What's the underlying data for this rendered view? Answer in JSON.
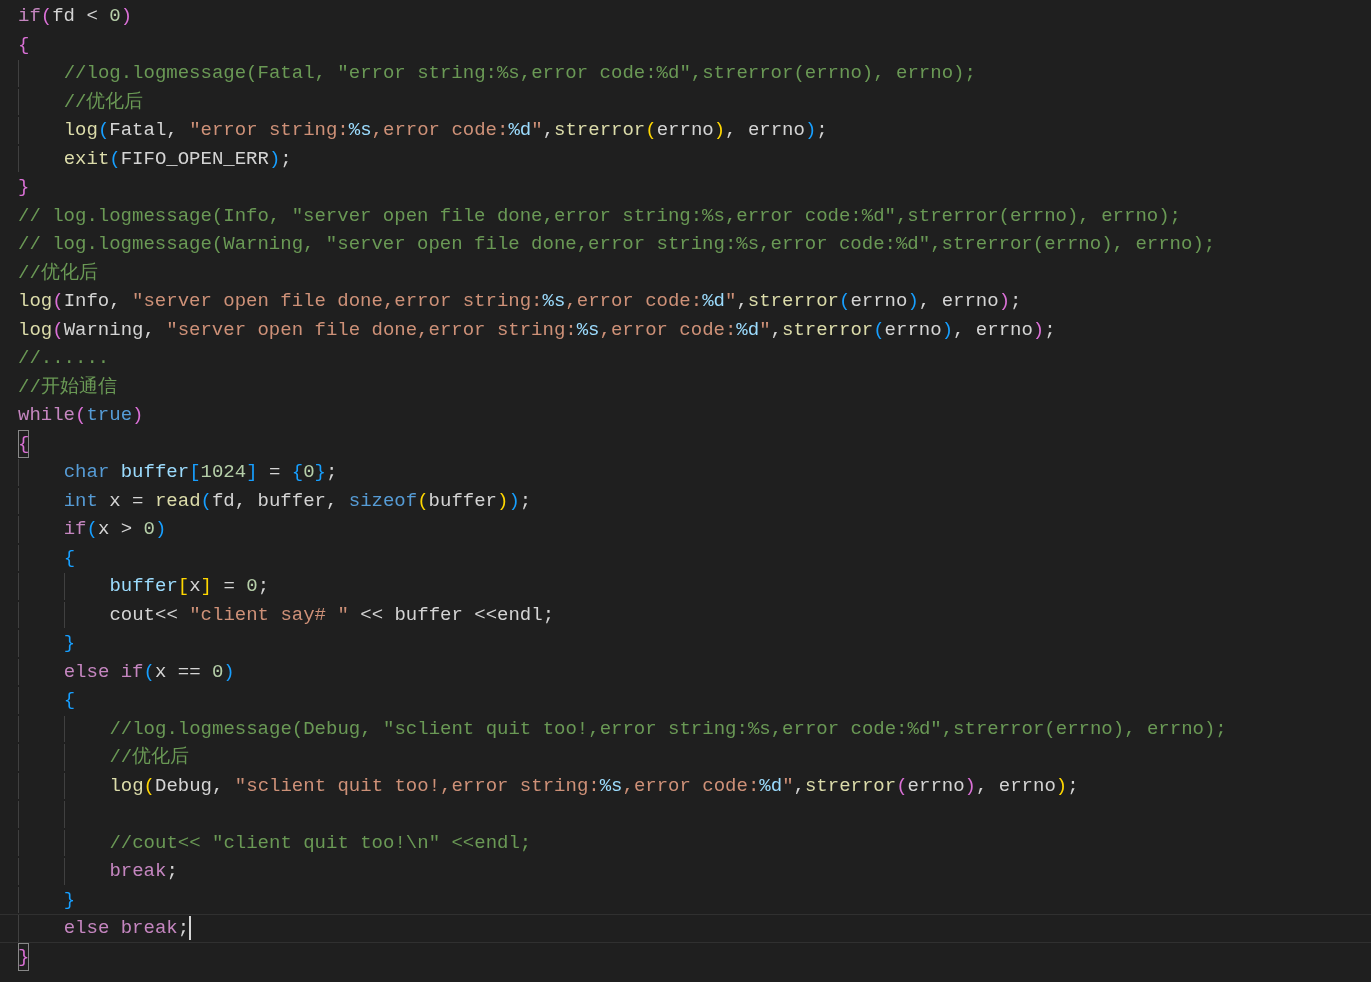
{
  "editor": {
    "lines": [
      {
        "active": false,
        "tokens": [
          {
            "kind": "keyword",
            "text": "if"
          },
          {
            "kind": "bracket1",
            "text": "("
          },
          {
            "kind": "plain",
            "text": "fd < "
          },
          {
            "kind": "number",
            "text": "0"
          },
          {
            "kind": "bracket1",
            "text": ")"
          }
        ]
      },
      {
        "active": false,
        "tokens": [
          {
            "kind": "bracket1",
            "text": "{"
          }
        ]
      },
      {
        "active": false,
        "tokens": [
          {
            "kind": "indent"
          },
          {
            "kind": "comment",
            "text": "//log.logmessage(Fatal, \"error string:%s,error code:%d\",strerror(errno), errno);"
          }
        ]
      },
      {
        "active": false,
        "tokens": [
          {
            "kind": "indent"
          },
          {
            "kind": "comment",
            "text": "//优化后"
          }
        ]
      },
      {
        "active": false,
        "tokens": [
          {
            "kind": "indent"
          },
          {
            "kind": "function",
            "text": "log"
          },
          {
            "kind": "bracket2",
            "text": "("
          },
          {
            "kind": "plain",
            "text": "Fatal, "
          },
          {
            "kind": "string",
            "text": "\"error string:"
          },
          {
            "kind": "format",
            "text": "%s"
          },
          {
            "kind": "string",
            "text": ",error code:"
          },
          {
            "kind": "format",
            "text": "%d"
          },
          {
            "kind": "string",
            "text": "\""
          },
          {
            "kind": "plain",
            "text": ","
          },
          {
            "kind": "function",
            "text": "strerror"
          },
          {
            "kind": "bracket3",
            "text": "("
          },
          {
            "kind": "plain",
            "text": "errno"
          },
          {
            "kind": "bracket3",
            "text": ")"
          },
          {
            "kind": "plain",
            "text": ", errno"
          },
          {
            "kind": "bracket2",
            "text": ")"
          },
          {
            "kind": "plain",
            "text": ";"
          }
        ]
      },
      {
        "active": false,
        "tokens": [
          {
            "kind": "indent"
          },
          {
            "kind": "function",
            "text": "exit"
          },
          {
            "kind": "bracket2",
            "text": "("
          },
          {
            "kind": "plain",
            "text": "FIFO_OPEN_ERR"
          },
          {
            "kind": "bracket2",
            "text": ")"
          },
          {
            "kind": "plain",
            "text": ";"
          }
        ]
      },
      {
        "active": false,
        "tokens": [
          {
            "kind": "bracket1",
            "text": "}"
          }
        ]
      },
      {
        "active": false,
        "tokens": [
          {
            "kind": "comment",
            "text": "// log.logmessage(Info, \"server open file done,error string:%s,error code:%d\",strerror(errno), errno);"
          }
        ]
      },
      {
        "active": false,
        "tokens": [
          {
            "kind": "comment",
            "text": "// log.logmessage(Warning, \"server open file done,error string:%s,error code:%d\",strerror(errno), errno);"
          }
        ]
      },
      {
        "active": false,
        "tokens": [
          {
            "kind": "comment",
            "text": "//优化后"
          }
        ]
      },
      {
        "active": false,
        "tokens": [
          {
            "kind": "function",
            "text": "log"
          },
          {
            "kind": "bracket1",
            "text": "("
          },
          {
            "kind": "plain",
            "text": "Info, "
          },
          {
            "kind": "string",
            "text": "\"server open file done,error string:"
          },
          {
            "kind": "format",
            "text": "%s"
          },
          {
            "kind": "string",
            "text": ",error code:"
          },
          {
            "kind": "format",
            "text": "%d"
          },
          {
            "kind": "string",
            "text": "\""
          },
          {
            "kind": "plain",
            "text": ","
          },
          {
            "kind": "function",
            "text": "strerror"
          },
          {
            "kind": "bracket2",
            "text": "("
          },
          {
            "kind": "plain",
            "text": "errno"
          },
          {
            "kind": "bracket2",
            "text": ")"
          },
          {
            "kind": "plain",
            "text": ", errno"
          },
          {
            "kind": "bracket1",
            "text": ")"
          },
          {
            "kind": "plain",
            "text": ";"
          }
        ]
      },
      {
        "active": false,
        "tokens": [
          {
            "kind": "function",
            "text": "log"
          },
          {
            "kind": "bracket1",
            "text": "("
          },
          {
            "kind": "plain",
            "text": "Warning, "
          },
          {
            "kind": "string",
            "text": "\"server open file done,error string:"
          },
          {
            "kind": "format",
            "text": "%s"
          },
          {
            "kind": "string",
            "text": ",error code:"
          },
          {
            "kind": "format",
            "text": "%d"
          },
          {
            "kind": "string",
            "text": "\""
          },
          {
            "kind": "plain",
            "text": ","
          },
          {
            "kind": "function",
            "text": "strerror"
          },
          {
            "kind": "bracket2",
            "text": "("
          },
          {
            "kind": "plain",
            "text": "errno"
          },
          {
            "kind": "bracket2",
            "text": ")"
          },
          {
            "kind": "plain",
            "text": ", errno"
          },
          {
            "kind": "bracket1",
            "text": ")"
          },
          {
            "kind": "plain",
            "text": ";"
          }
        ]
      },
      {
        "active": false,
        "tokens": [
          {
            "kind": "comment",
            "text": "//......"
          }
        ]
      },
      {
        "active": false,
        "tokens": [
          {
            "kind": "comment",
            "text": "//开始通信"
          }
        ]
      },
      {
        "active": false,
        "tokens": [
          {
            "kind": "keyword",
            "text": "while"
          },
          {
            "kind": "bracket1",
            "text": "("
          },
          {
            "kind": "type",
            "text": "true"
          },
          {
            "kind": "bracket1",
            "text": ")"
          }
        ]
      },
      {
        "active": false,
        "tokens": [
          {
            "kind": "matched",
            "text": "{"
          }
        ]
      },
      {
        "active": false,
        "tokens": [
          {
            "kind": "indent"
          },
          {
            "kind": "type",
            "text": "char"
          },
          {
            "kind": "variable",
            "text": " buffer"
          },
          {
            "kind": "bracket2",
            "text": "["
          },
          {
            "kind": "number",
            "text": "1024"
          },
          {
            "kind": "bracket2",
            "text": "]"
          },
          {
            "kind": "plain",
            "text": " = "
          },
          {
            "kind": "bracket2",
            "text": "{"
          },
          {
            "kind": "number",
            "text": "0"
          },
          {
            "kind": "bracket2",
            "text": "}"
          },
          {
            "kind": "plain",
            "text": ";"
          }
        ]
      },
      {
        "active": false,
        "tokens": [
          {
            "kind": "indent"
          },
          {
            "kind": "type",
            "text": "int"
          },
          {
            "kind": "plain",
            "text": " x = "
          },
          {
            "kind": "function",
            "text": "read"
          },
          {
            "kind": "bracket2",
            "text": "("
          },
          {
            "kind": "plain",
            "text": "fd, buffer, "
          },
          {
            "kind": "type",
            "text": "sizeof"
          },
          {
            "kind": "bracket3",
            "text": "("
          },
          {
            "kind": "plain",
            "text": "buffer"
          },
          {
            "kind": "bracket3",
            "text": ")"
          },
          {
            "kind": "bracket2",
            "text": ")"
          },
          {
            "kind": "plain",
            "text": ";"
          }
        ]
      },
      {
        "active": false,
        "tokens": [
          {
            "kind": "indent"
          },
          {
            "kind": "keyword",
            "text": "if"
          },
          {
            "kind": "bracket2",
            "text": "("
          },
          {
            "kind": "plain",
            "text": "x > "
          },
          {
            "kind": "number",
            "text": "0"
          },
          {
            "kind": "bracket2",
            "text": ")"
          }
        ]
      },
      {
        "active": false,
        "tokens": [
          {
            "kind": "indent"
          },
          {
            "kind": "bracket2",
            "text": "{"
          }
        ]
      },
      {
        "active": false,
        "tokens": [
          {
            "kind": "indent"
          },
          {
            "kind": "indent"
          },
          {
            "kind": "variable",
            "text": "buffer"
          },
          {
            "kind": "bracket3",
            "text": "["
          },
          {
            "kind": "plain",
            "text": "x"
          },
          {
            "kind": "bracket3",
            "text": "]"
          },
          {
            "kind": "plain",
            "text": " = "
          },
          {
            "kind": "number",
            "text": "0"
          },
          {
            "kind": "plain",
            "text": ";"
          }
        ]
      },
      {
        "active": false,
        "tokens": [
          {
            "kind": "indent"
          },
          {
            "kind": "indent"
          },
          {
            "kind": "plain",
            "text": "cout<< "
          },
          {
            "kind": "string",
            "text": "\"client say# \""
          },
          {
            "kind": "plain",
            "text": " << buffer <<endl;"
          }
        ]
      },
      {
        "active": false,
        "tokens": [
          {
            "kind": "indent"
          },
          {
            "kind": "bracket2",
            "text": "}"
          }
        ]
      },
      {
        "active": false,
        "tokens": [
          {
            "kind": "indent"
          },
          {
            "kind": "keyword",
            "text": "else if"
          },
          {
            "kind": "bracket2",
            "text": "("
          },
          {
            "kind": "plain",
            "text": "x == "
          },
          {
            "kind": "number",
            "text": "0"
          },
          {
            "kind": "bracket2",
            "text": ")"
          }
        ]
      },
      {
        "active": false,
        "tokens": [
          {
            "kind": "indent"
          },
          {
            "kind": "bracket2",
            "text": "{"
          }
        ]
      },
      {
        "active": false,
        "tokens": [
          {
            "kind": "indent"
          },
          {
            "kind": "indent"
          },
          {
            "kind": "comment",
            "text": "//log.logmessage(Debug, \"sclient quit too!,error string:%s,error code:%d\",strerror(errno), errno);"
          }
        ]
      },
      {
        "active": false,
        "tokens": [
          {
            "kind": "indent"
          },
          {
            "kind": "indent"
          },
          {
            "kind": "comment",
            "text": "//优化后"
          }
        ]
      },
      {
        "active": false,
        "tokens": [
          {
            "kind": "indent"
          },
          {
            "kind": "indent"
          },
          {
            "kind": "function",
            "text": "log"
          },
          {
            "kind": "bracket3",
            "text": "("
          },
          {
            "kind": "plain",
            "text": "Debug, "
          },
          {
            "kind": "string",
            "text": "\"sclient quit too!,error string:"
          },
          {
            "kind": "format",
            "text": "%s"
          },
          {
            "kind": "string",
            "text": ",error code:"
          },
          {
            "kind": "format",
            "text": "%d"
          },
          {
            "kind": "string",
            "text": "\""
          },
          {
            "kind": "plain",
            "text": ","
          },
          {
            "kind": "function",
            "text": "strerror"
          },
          {
            "kind": "bracket1",
            "text": "("
          },
          {
            "kind": "plain",
            "text": "errno"
          },
          {
            "kind": "bracket1",
            "text": ")"
          },
          {
            "kind": "plain",
            "text": ", errno"
          },
          {
            "kind": "bracket3",
            "text": ")"
          },
          {
            "kind": "plain",
            "text": ";"
          }
        ]
      },
      {
        "active": false,
        "tokens": [
          {
            "kind": "indent"
          },
          {
            "kind": "indent"
          }
        ]
      },
      {
        "active": false,
        "tokens": [
          {
            "kind": "indent"
          },
          {
            "kind": "indent"
          },
          {
            "kind": "comment",
            "text": "//cout<< \"client quit too!\\n\" <<endl;"
          }
        ]
      },
      {
        "active": false,
        "tokens": [
          {
            "kind": "indent"
          },
          {
            "kind": "indent"
          },
          {
            "kind": "keyword",
            "text": "break"
          },
          {
            "kind": "plain",
            "text": ";"
          }
        ]
      },
      {
        "active": false,
        "tokens": [
          {
            "kind": "indent"
          },
          {
            "kind": "bracket2",
            "text": "}"
          }
        ]
      },
      {
        "active": true,
        "tokens": [
          {
            "kind": "indent"
          },
          {
            "kind": "keyword",
            "text": "else break"
          },
          {
            "kind": "plain",
            "text": ";"
          }
        ]
      },
      {
        "active": false,
        "tokens": [
          {
            "kind": "matched",
            "text": "}"
          }
        ]
      }
    ]
  }
}
